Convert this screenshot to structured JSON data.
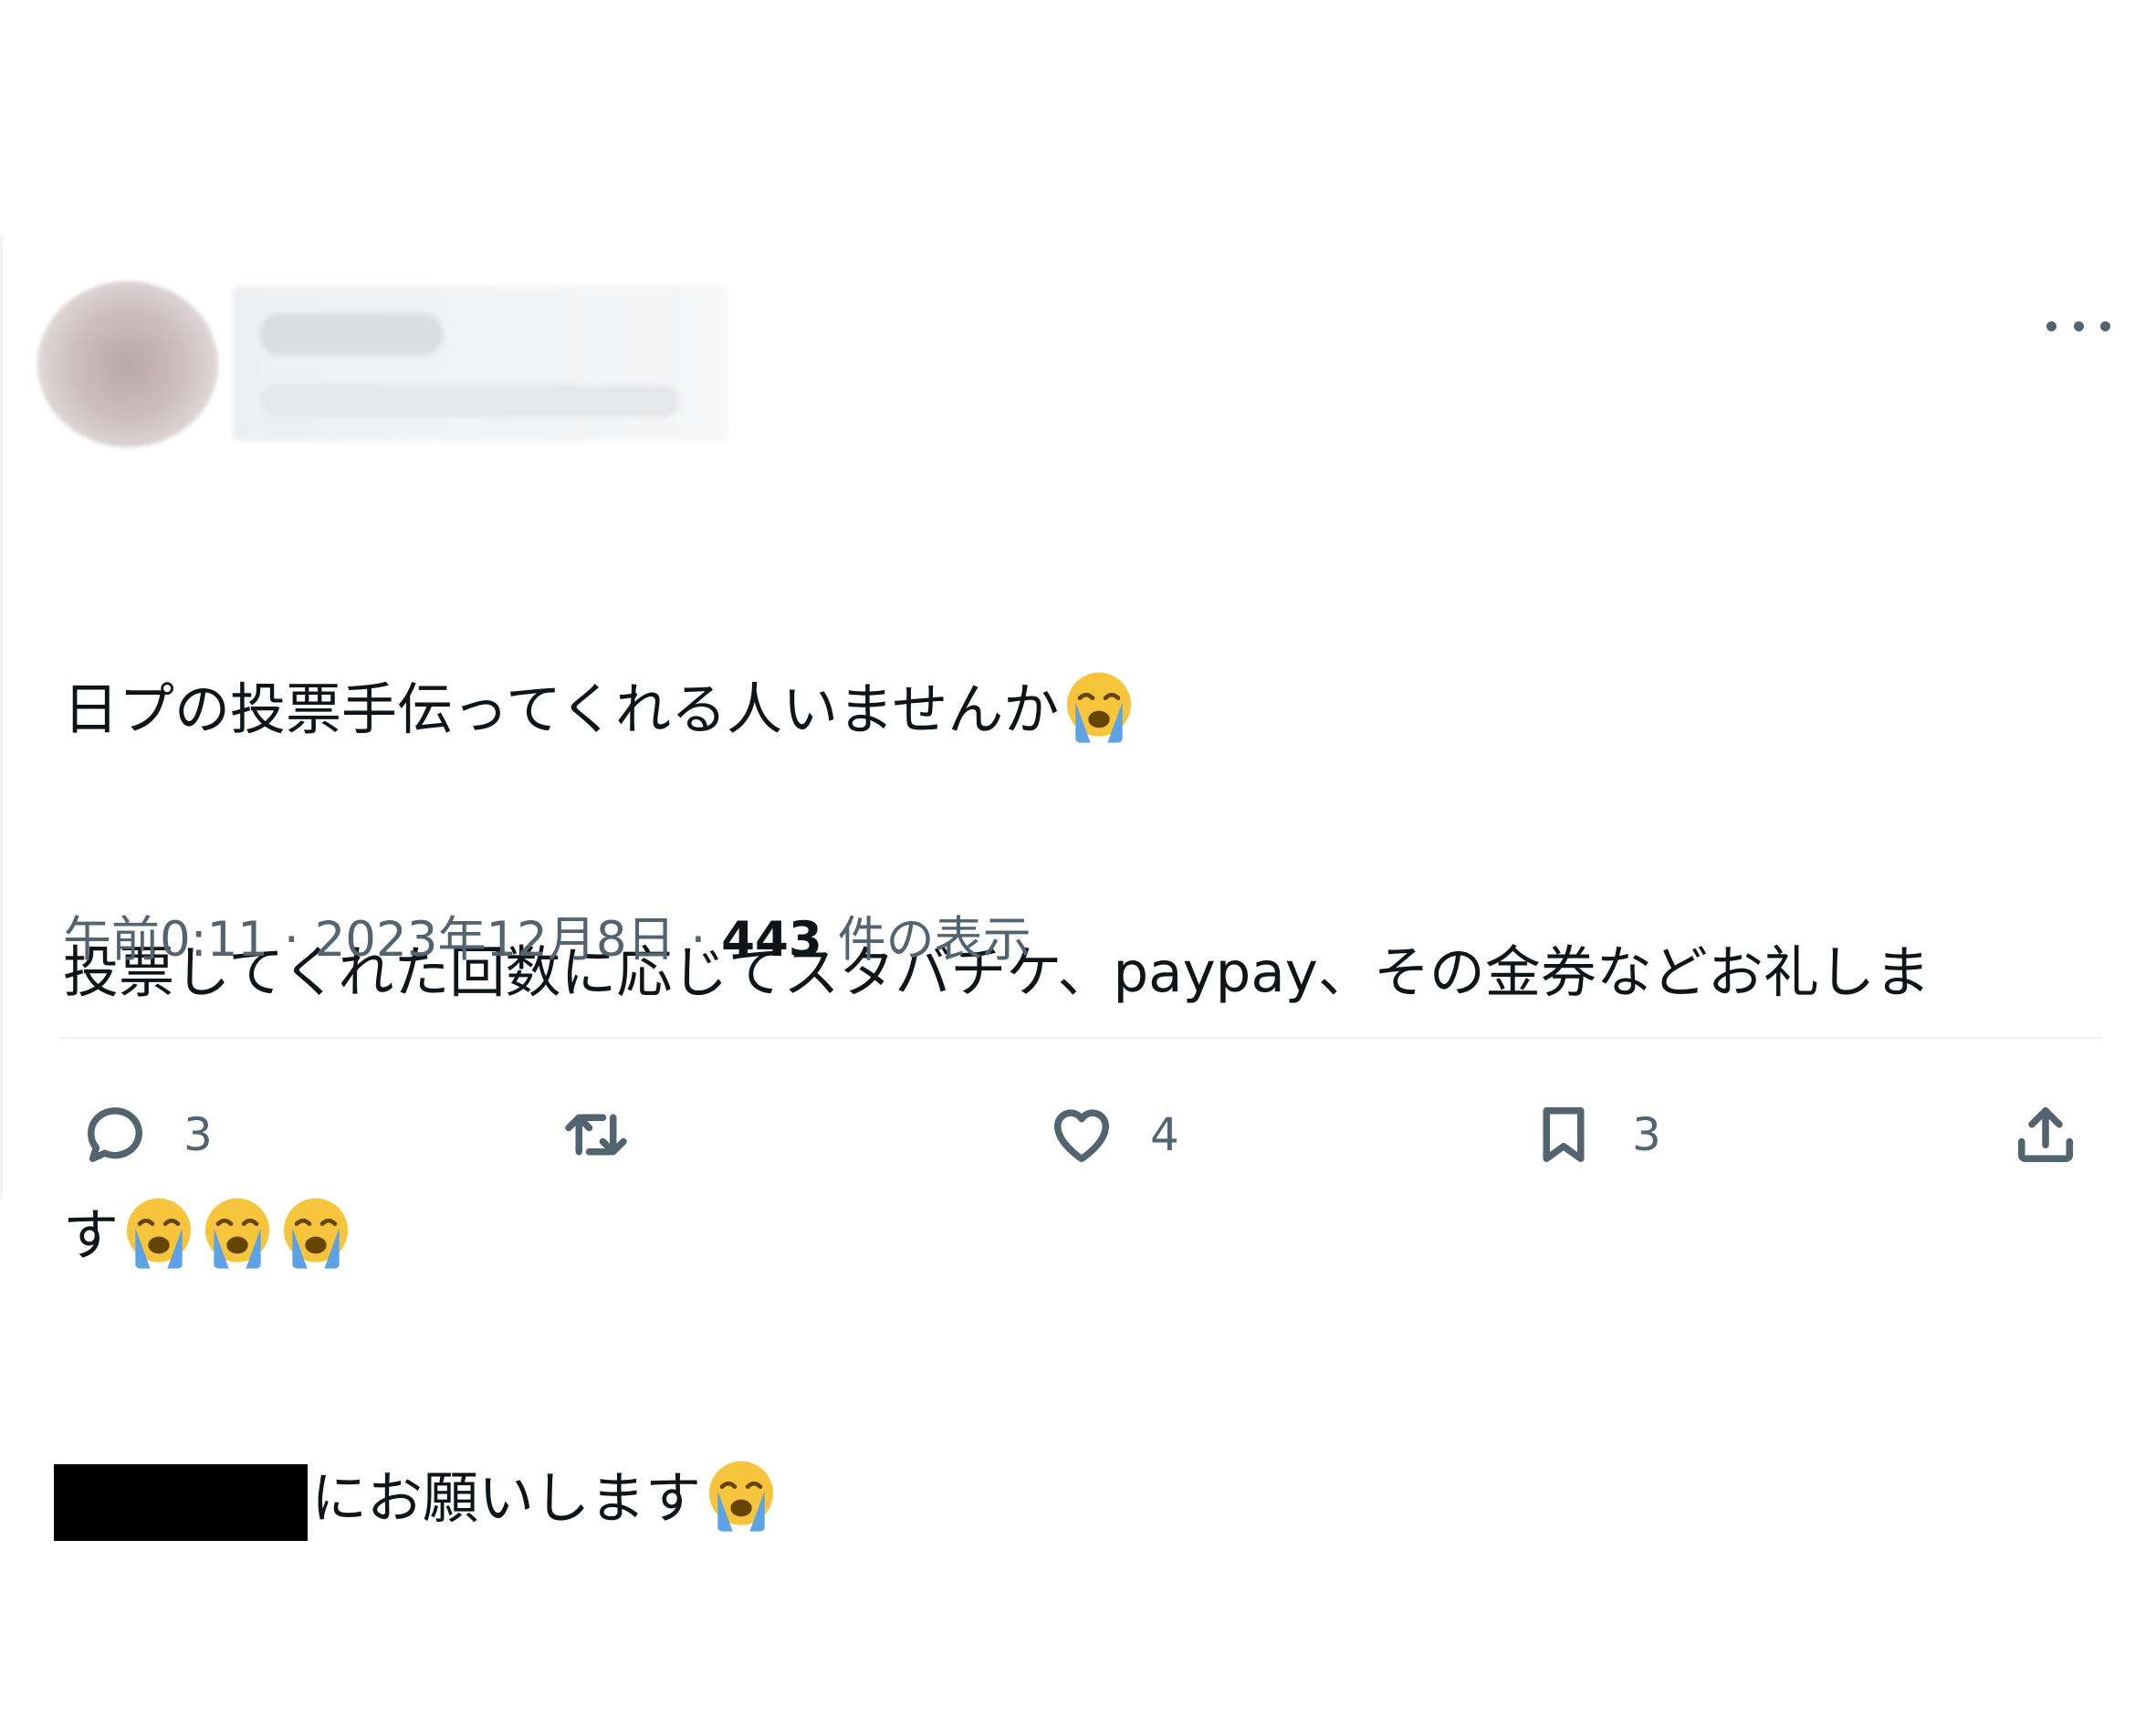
{
  "tweet": {
    "text_lines": [
      "日プの投票手伝ってくれる人いませんか",
      "投票してくれた回数に応じてスタバチケ、paypay、その金券などお礼しま",
      "す",
      "にお願いします"
    ],
    "emoji": "loudly-crying-face"
  },
  "meta": {
    "time": "午前0:11",
    "sep1": " · ",
    "date": "2023年12月8日",
    "sep2": " · ",
    "views_count": "443",
    "views_label": " 件の表示"
  },
  "actions": {
    "reply_count": "3",
    "like_count": "4",
    "bookmark_count": "3"
  },
  "colors": {
    "text": "#0f1419",
    "secondary": "#536471",
    "divider": "#eff3f4",
    "emoji_face": "#f7c53c",
    "emoji_tears": "#5da2e6"
  }
}
